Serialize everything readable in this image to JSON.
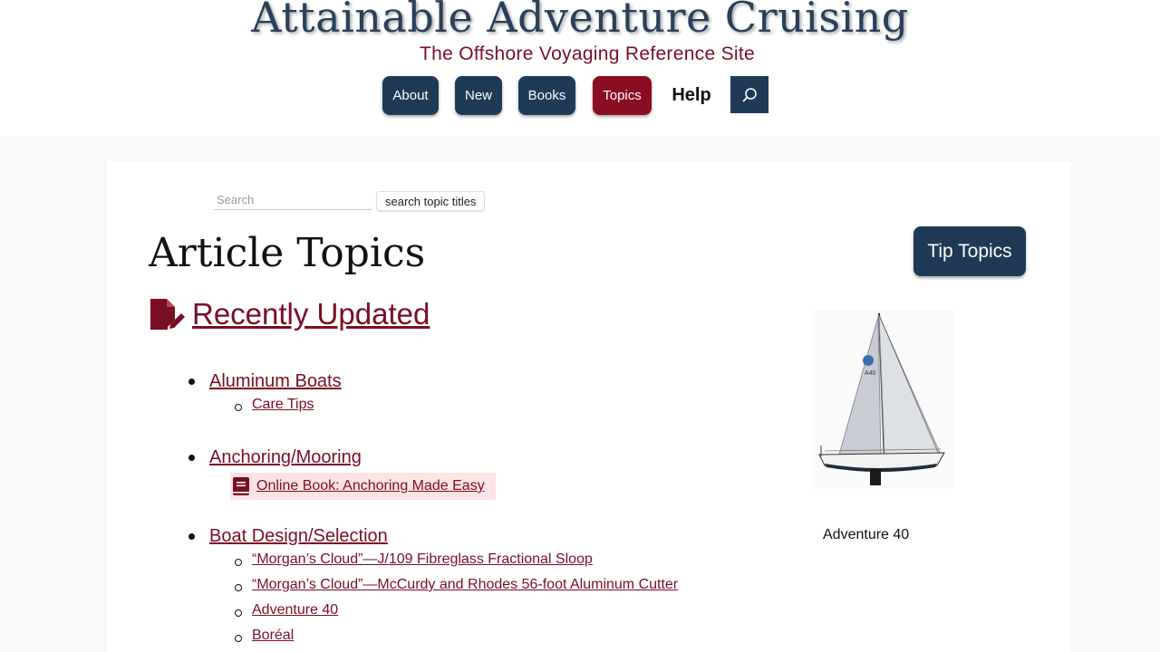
{
  "header": {
    "title": "Attainable Adventure Cruising",
    "subtitle": "The Offshore Voyaging Reference Site"
  },
  "nav": {
    "about": "About",
    "new": "New",
    "books": "Books",
    "topics": "Topics",
    "help": "Help",
    "search_icon": "search-icon"
  },
  "search": {
    "placeholder": "Search",
    "button": "search topic titles"
  },
  "page": {
    "title": "Article Topics",
    "tip_topics": "Tip Topics",
    "recently_updated": "Recently Updated",
    "recently_updated_icon": "file-edit-icon"
  },
  "topics": [
    {
      "label": "Aluminum Boats",
      "subs": [
        "Care Tips"
      ]
    },
    {
      "label": "Anchoring/Mooring",
      "book": "Online Book: Anchoring Made Easy"
    },
    {
      "label": "Boat Design/Selection",
      "subs": [
        "“Morgan’s Cloud”—J/109 Fibreglass Fractional Sloop",
        "“Morgan’s Cloud”—McCurdy and Rhodes 56-foot Aluminum Cutter",
        "Adventure 40",
        "Boréal"
      ]
    }
  ],
  "feature": {
    "caption": "Adventure 40"
  },
  "colors": {
    "navy": "#1f3a57",
    "burgundy": "#8a0d22",
    "link": "#7a0e22",
    "highlight": "#fbe3e6"
  }
}
